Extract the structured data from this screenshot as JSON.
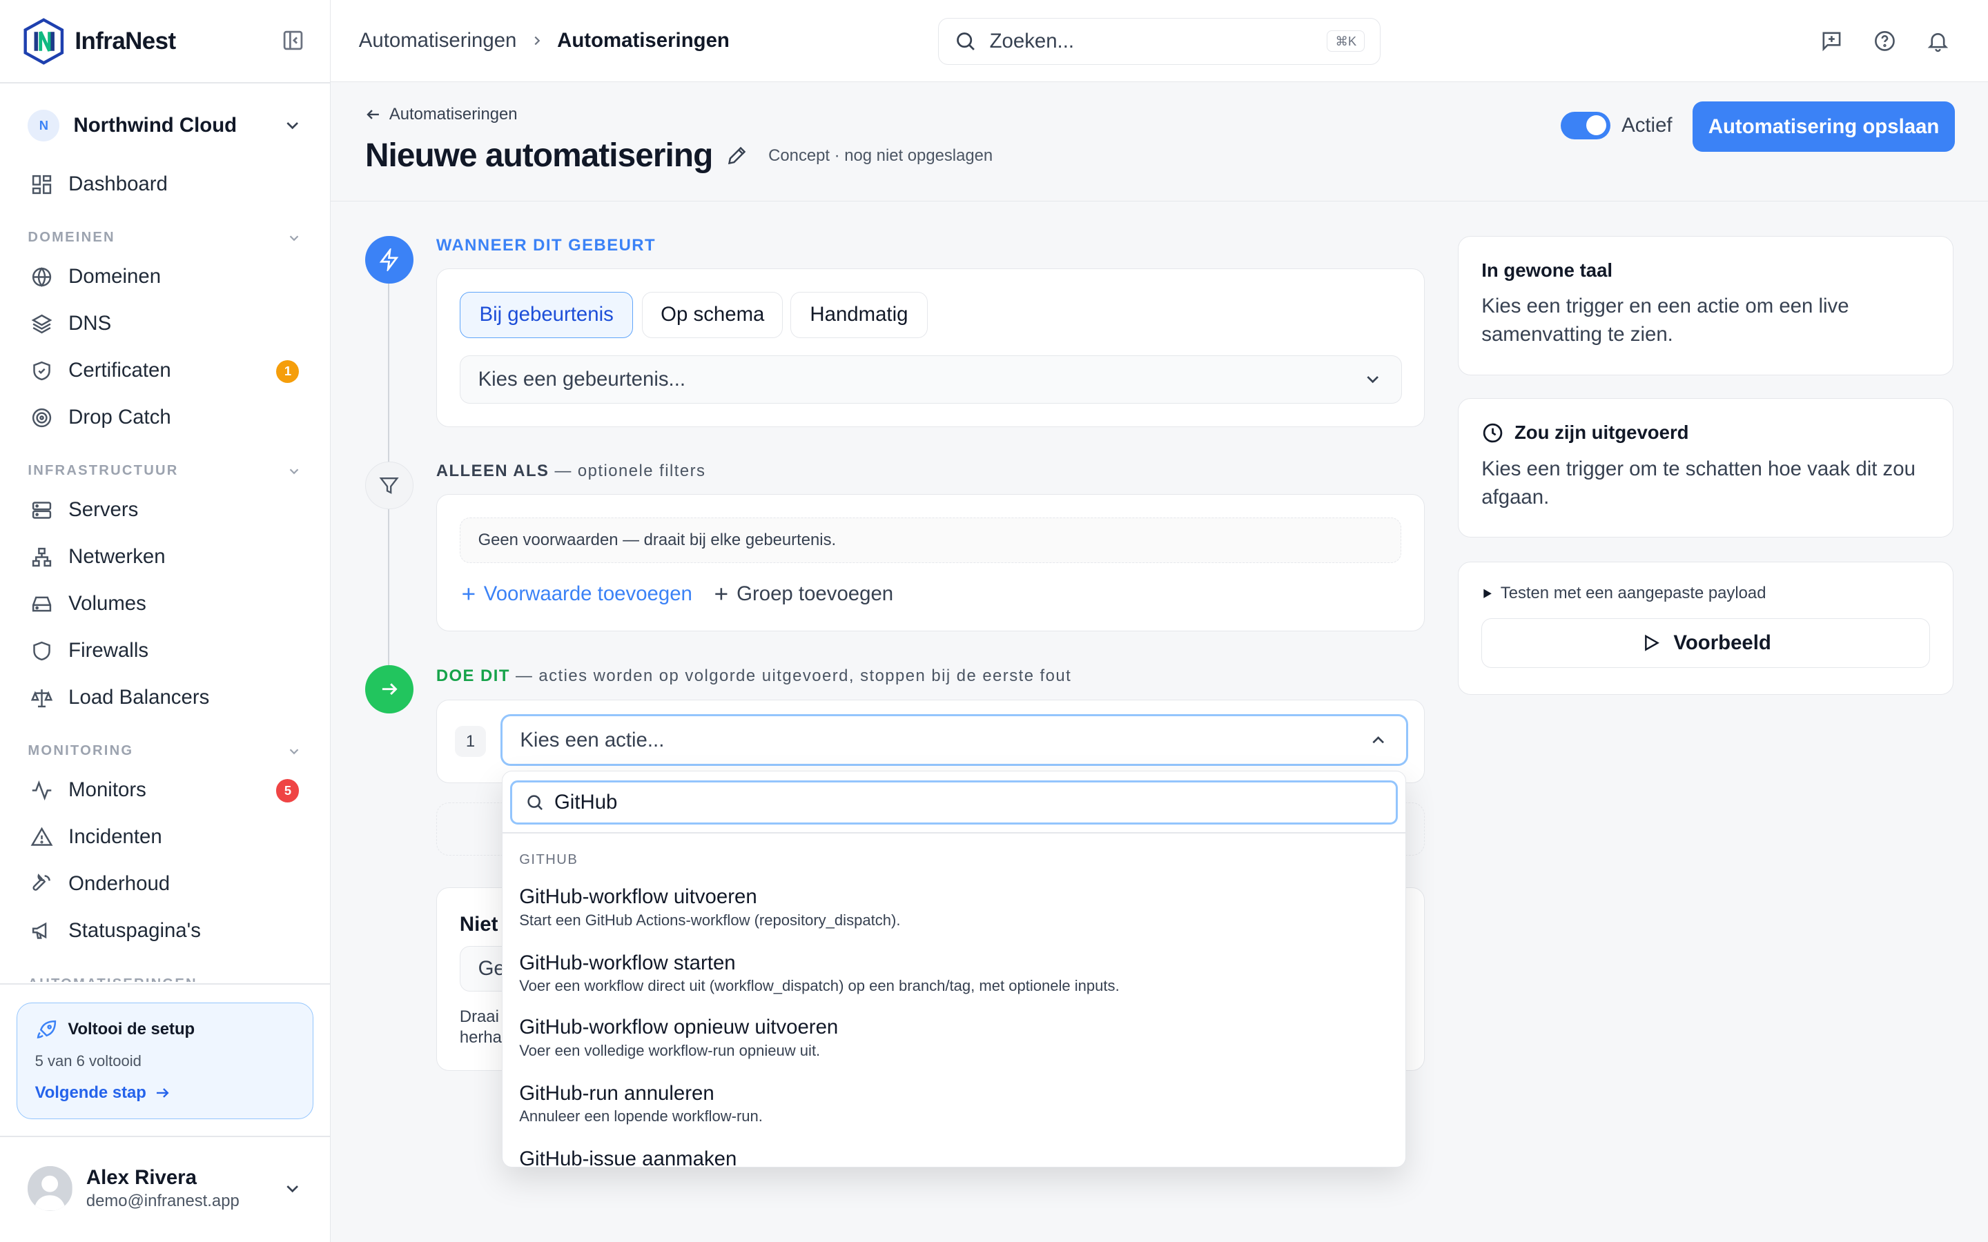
{
  "app": {
    "name": "InfraNest"
  },
  "workspace": {
    "initial": "N",
    "name": "Northwind Cloud"
  },
  "sidebar": {
    "dashboard": "Dashboard",
    "sections": [
      {
        "title": "DOMEINEN",
        "items": [
          {
            "label": "Domeinen",
            "icon": "globe-icon"
          },
          {
            "label": "DNS",
            "icon": "layers-icon"
          },
          {
            "label": "Certificaten",
            "icon": "shield-check-icon",
            "badge": "1"
          },
          {
            "label": "Drop Catch",
            "icon": "target-icon"
          }
        ]
      },
      {
        "title": "INFRASTRUCTUUR",
        "items": [
          {
            "label": "Servers",
            "icon": "server-icon"
          },
          {
            "label": "Netwerken",
            "icon": "network-icon"
          },
          {
            "label": "Volumes",
            "icon": "hard-drive-icon"
          },
          {
            "label": "Firewalls",
            "icon": "shield-icon"
          },
          {
            "label": "Load Balancers",
            "icon": "scale-icon"
          }
        ]
      },
      {
        "title": "MONITORING",
        "items": [
          {
            "label": "Monitors",
            "icon": "activity-icon",
            "badge": "5"
          },
          {
            "label": "Incidenten",
            "icon": "alert-triangle-icon"
          },
          {
            "label": "Onderhoud",
            "icon": "wrench-icon"
          },
          {
            "label": "Statuspagina's",
            "icon": "megaphone-icon"
          }
        ]
      },
      {
        "title": "AUTOMATISERINGEN"
      }
    ],
    "setup": {
      "title": "Voltooi de setup",
      "progress": "5 van 6 voltooid",
      "next": "Volgende stap"
    },
    "user": {
      "name": "Alex Rivera",
      "email": "demo@infranest.app"
    }
  },
  "topbar": {
    "breadcrumb": [
      "Automatiseringen",
      "Automatiseringen"
    ],
    "search_placeholder": "Zoeken...",
    "search_shortcut": "⌘K"
  },
  "page": {
    "back": "Automatiseringen",
    "title": "Nieuwe automatisering",
    "status": "Concept · nog niet opgeslagen",
    "active_label": "Actief",
    "active": true,
    "save": "Automatisering opslaan"
  },
  "trigger": {
    "label": "WANNEER DIT GEBEURT",
    "tabs": [
      "Bij gebeurtenis",
      "Op schema",
      "Handmatig"
    ],
    "active_tab": 0,
    "select_placeholder": "Kies een gebeurtenis..."
  },
  "filters": {
    "label": "ALLEEN ALS",
    "sublabel": " — optionele filters",
    "empty": "Geen voorwaarden — draait bij elke gebeurtenis.",
    "add_condition": "Voorwaarde toevoegen",
    "add_group": "Groep toevoegen"
  },
  "actions": {
    "label": "DOE DIT",
    "sublabel": " — acties worden op volgorde uitgevoerd, stoppen bij de eerste fout",
    "step_number": "1",
    "select_placeholder": "Kies een actie...",
    "hidden_card_title": "Niet",
    "hidden_card_field": "Ge",
    "hidden_card_text1": "Draai",
    "hidden_card_text2": "herha"
  },
  "dropdown": {
    "search_value": "GitHub",
    "group": "GITHUB",
    "items": [
      {
        "title": "GitHub-workflow uitvoeren",
        "desc": "Start een GitHub Actions-workflow (repository_dispatch)."
      },
      {
        "title": "GitHub-workflow starten",
        "desc": "Voer een workflow direct uit (workflow_dispatch) op een branch/tag, met optionele inputs."
      },
      {
        "title": "GitHub-workflow opnieuw uitvoeren",
        "desc": "Voer een volledige workflow-run opnieuw uit."
      },
      {
        "title": "GitHub-run annuleren",
        "desc": "Annuleer een lopende workflow-run."
      },
      {
        "title": "GitHub-issue aanmaken",
        "desc": ""
      }
    ]
  },
  "right": {
    "plain": {
      "title": "In gewone taal",
      "text": "Kies een trigger en een actie om een live samenvatting te zien."
    },
    "would_run": {
      "title": "Zou zijn uitgevoerd",
      "text": "Kies een trigger om te schatten hoe vaak dit zou afgaan."
    },
    "test": {
      "summary": "Testen met een aangepaste payload",
      "button": "Voorbeeld"
    }
  },
  "colors": {
    "accent": "#3b82f6",
    "success": "#22c55e",
    "warning": "#f59e0b",
    "danger": "#ef4444"
  }
}
